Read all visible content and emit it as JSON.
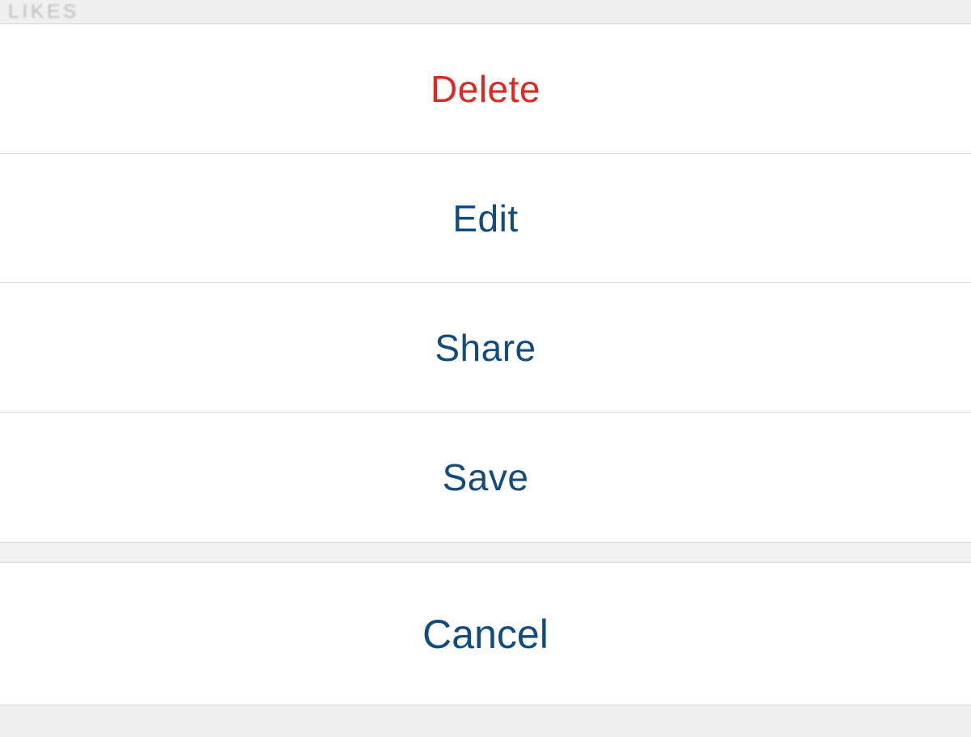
{
  "header": {
    "fragment": "LIKES"
  },
  "actions": [
    {
      "label": "Delete",
      "style": "destructive"
    },
    {
      "label": "Edit",
      "style": "normal"
    },
    {
      "label": "Share",
      "style": "normal"
    },
    {
      "label": "Save",
      "style": "normal"
    }
  ],
  "cancel": {
    "label": "Cancel"
  },
  "colors": {
    "destructive": "#dd2823",
    "primary": "#134c7c",
    "separator": "#dcdcdc",
    "background": "#f2f2f2"
  }
}
